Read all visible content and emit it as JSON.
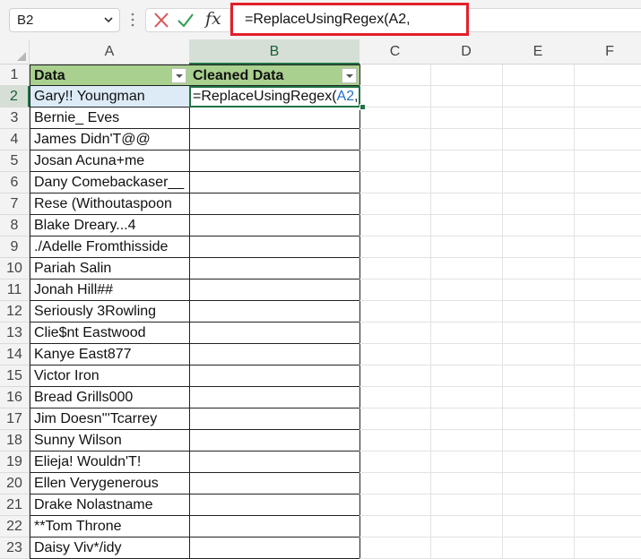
{
  "name_box": {
    "value": "B2"
  },
  "formula_bar": {
    "fx_label": "fx",
    "formula": "=ReplaceUsingRegex(A2,",
    "highlight_color": "#e3202a"
  },
  "columns": [
    "A",
    "B",
    "C",
    "D",
    "E",
    "F"
  ],
  "table": {
    "headers": [
      "Data",
      "Cleaned Data"
    ],
    "header_fill": "#a9d08e",
    "rows": [
      "Gary!! Youngman",
      "Bernie_ Eves",
      "James Didn'T@@",
      "Josan Acuna+me",
      "Dany Comebackaser__",
      "Rese (Withoutaspoon",
      "Blake Dreary...4",
      "./Adelle Fromthisside",
      "Pariah Salin",
      "Jonah Hill##",
      "Seriously 3Rowling",
      "Clie$nt Eastwood",
      "Kanye East877",
      "Victor Iron",
      "Bread Grills000",
      "Jim Doesn'''Tcarrey",
      "Sunny Wilson",
      "Elieja! Wouldn'T!",
      "Ellen Verygenerous",
      "Drake Nolastname",
      "**Tom Throne",
      "Daisy Viv*/idy"
    ],
    "editing_cell": {
      "prefix": "=ReplaceUsingRegex(",
      "ref": "A2",
      "suffix": ","
    }
  },
  "row_numbers": [
    "1",
    "2",
    "3",
    "4",
    "5",
    "6",
    "7",
    "8",
    "9",
    "10",
    "11",
    "12",
    "13",
    "14",
    "15",
    "16",
    "17",
    "18",
    "19",
    "20",
    "21",
    "22",
    "23"
  ],
  "accent": "#217346"
}
